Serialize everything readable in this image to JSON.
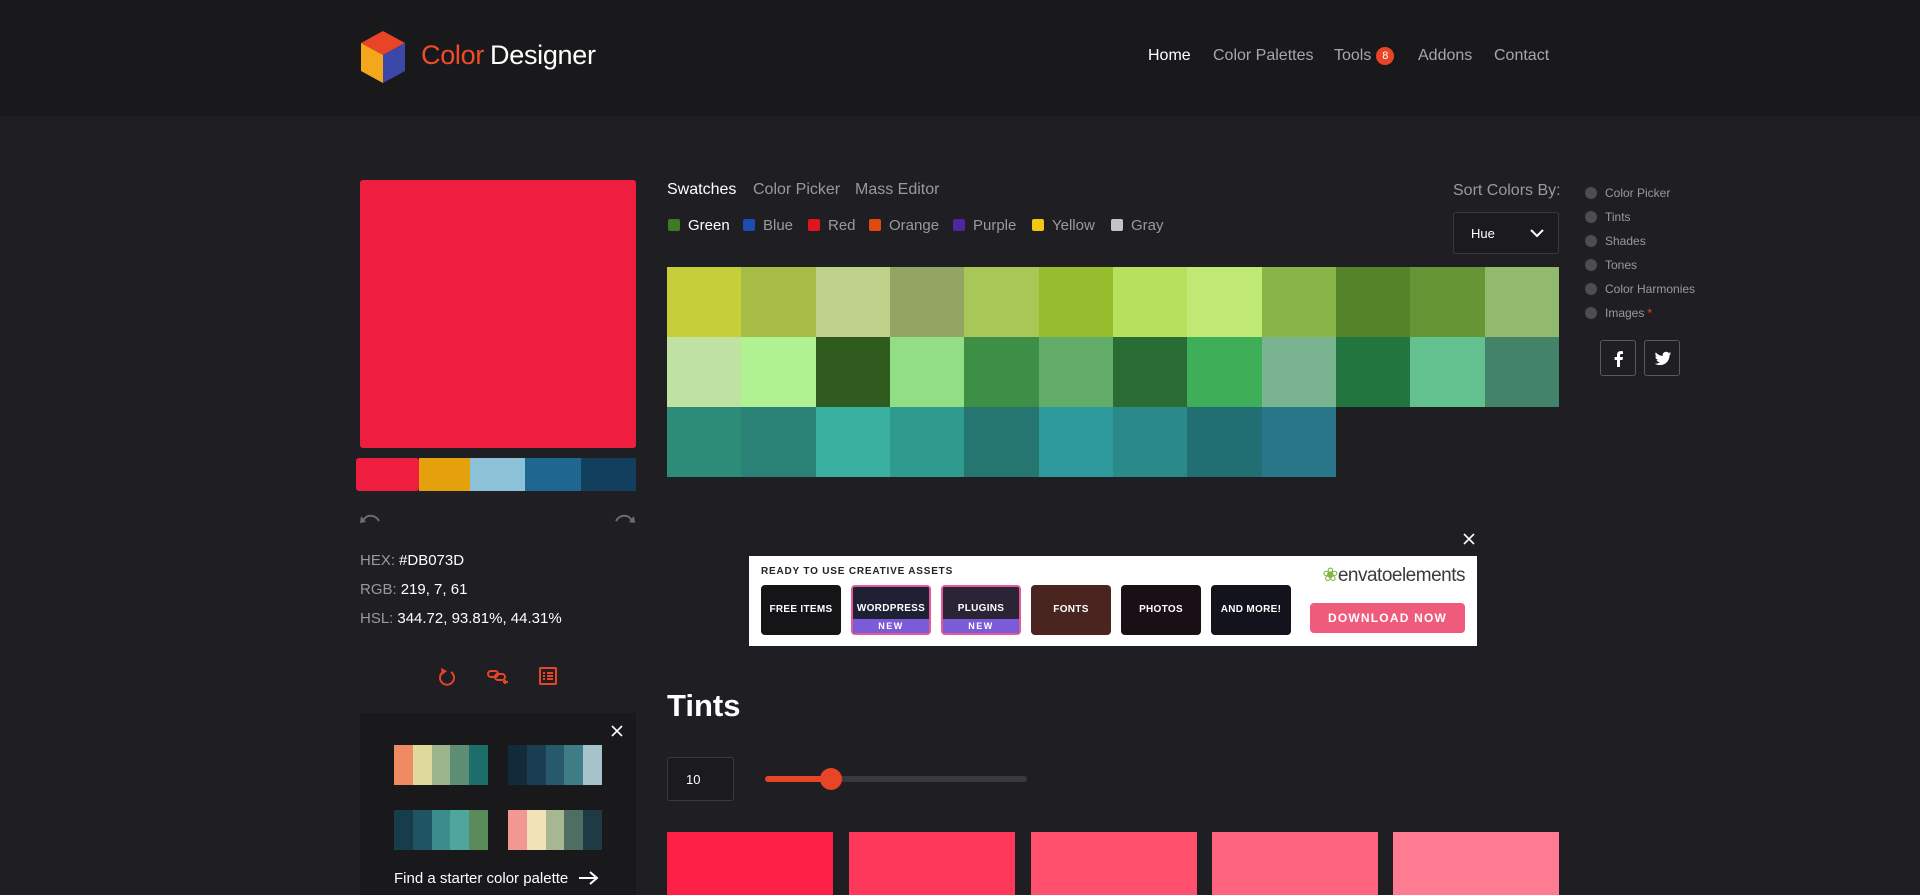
{
  "header": {
    "brand_part1": "Color",
    "brand_part2": "Designer",
    "logo_icon": "cube-logo-icon",
    "nav": [
      {
        "label": "Home",
        "active": true
      },
      {
        "label": "Color Palettes",
        "active": false
      },
      {
        "label": "Tools",
        "active": false,
        "badge": "8"
      },
      {
        "label": "Addons",
        "active": false
      },
      {
        "label": "Contact",
        "active": false
      }
    ]
  },
  "current_color": {
    "swatch": "#ef1e40",
    "hex_label": "HEX:",
    "hex_value": "#DB073D",
    "rgb_label": "RGB:",
    "rgb_value": "219, 7, 61",
    "hsl_label": "HSL:",
    "hsl_value": "344.72, 93.81%, 44.31%"
  },
  "palette_strip": [
    "#ef1e40",
    "#e5a10b",
    "#8bc2d8",
    "#1f6690",
    "#123f5e"
  ],
  "icons": {
    "undo": "undo-icon",
    "redo": "redo-icon",
    "reset": "refresh-icon",
    "link": "link-add-icon",
    "list": "list-icon"
  },
  "starter": {
    "link_label": "Find a starter color palette",
    "palettes": [
      [
        "#ef8a62",
        "#e0d99e",
        "#9db58c",
        "#5e8d75",
        "#1c6e6a"
      ],
      [
        "#132a3a",
        "#1b3d52",
        "#27596c",
        "#3e7d85",
        "#a6c3cc"
      ],
      [
        "#173d4b",
        "#1f5563",
        "#3b8d8d",
        "#4ea69d",
        "#5b8b5b"
      ],
      [
        "#f29892",
        "#f1e3b7",
        "#a6b791",
        "#4f6d63",
        "#1e3a45"
      ]
    ]
  },
  "tabs": [
    {
      "label": "Swatches",
      "active": true
    },
    {
      "label": "Color Picker",
      "active": false
    },
    {
      "label": "Mass Editor",
      "active": false
    }
  ],
  "filters": [
    {
      "label": "Green",
      "color": "#3d7a24",
      "active": true
    },
    {
      "label": "Blue",
      "color": "#1e4bb0",
      "active": false
    },
    {
      "label": "Red",
      "color": "#e0151b",
      "active": false
    },
    {
      "label": "Orange",
      "color": "#e04a12",
      "active": false
    },
    {
      "label": "Purple",
      "color": "#4f26a0",
      "active": false
    },
    {
      "label": "Yellow",
      "color": "#f5c611",
      "active": false
    },
    {
      "label": "Gray",
      "color": "#c4c4c4",
      "active": false
    }
  ],
  "sort": {
    "label": "Sort Colors By:",
    "value": "Hue"
  },
  "swatch_rows": [
    [
      "#c5cf38",
      "#a8bb44",
      "#bfd08b",
      "#94a563",
      "#a9c756",
      "#97bd2f",
      "#b7e05c",
      "#bfe874",
      "#88b548",
      "#558428",
      "#669535",
      "#92ba6f"
    ],
    [
      "#bfe1a2",
      "#b0f291",
      "#305b1f",
      "#92de85",
      "#3c8f45",
      "#63ad6a",
      "#2a6d34",
      "#3eaf58",
      "#79b38f",
      "#21763f",
      "#63c08f",
      "#438369"
    ],
    [
      "#2d8c77",
      "#2a8276",
      "#3ab0a0",
      "#2f9b8f",
      "#257570",
      "#2e9a9b",
      "#2a8a8a",
      "#216f72",
      "#287687"
    ]
  ],
  "side_nav": [
    {
      "label": "Color Picker"
    },
    {
      "label": "Tints"
    },
    {
      "label": "Shades"
    },
    {
      "label": "Tones"
    },
    {
      "label": "Color Harmonies"
    },
    {
      "label": "Images",
      "star": "*"
    }
  ],
  "social": [
    "facebook-icon",
    "twitter-icon"
  ],
  "ad": {
    "headline": "READY TO USE CREATIVE ASSETS",
    "logo_text": "envato",
    "logo_text2": "elements",
    "tiles": [
      {
        "label": "FREE ITEMS",
        "color": "#151517"
      },
      {
        "label": "WORDPRESS",
        "color": "#1f2034",
        "new": "NEW"
      },
      {
        "label": "PLUGINS",
        "color": "#2a2436",
        "new": "NEW"
      },
      {
        "label": "FONTS",
        "color": "#4a2520"
      },
      {
        "label": "PHOTOS",
        "color": "#1a0f14"
      },
      {
        "label": "AND MORE!",
        "color": "#12131c"
      }
    ],
    "cta": "DOWNLOAD NOW"
  },
  "tints": {
    "title": "Tints",
    "count": "10",
    "slider_fraction": 0.25,
    "swatches": [
      "#fe2046",
      "#fe385a",
      "#fe4f6c",
      "#fe6480",
      "#fe7b92"
    ]
  }
}
